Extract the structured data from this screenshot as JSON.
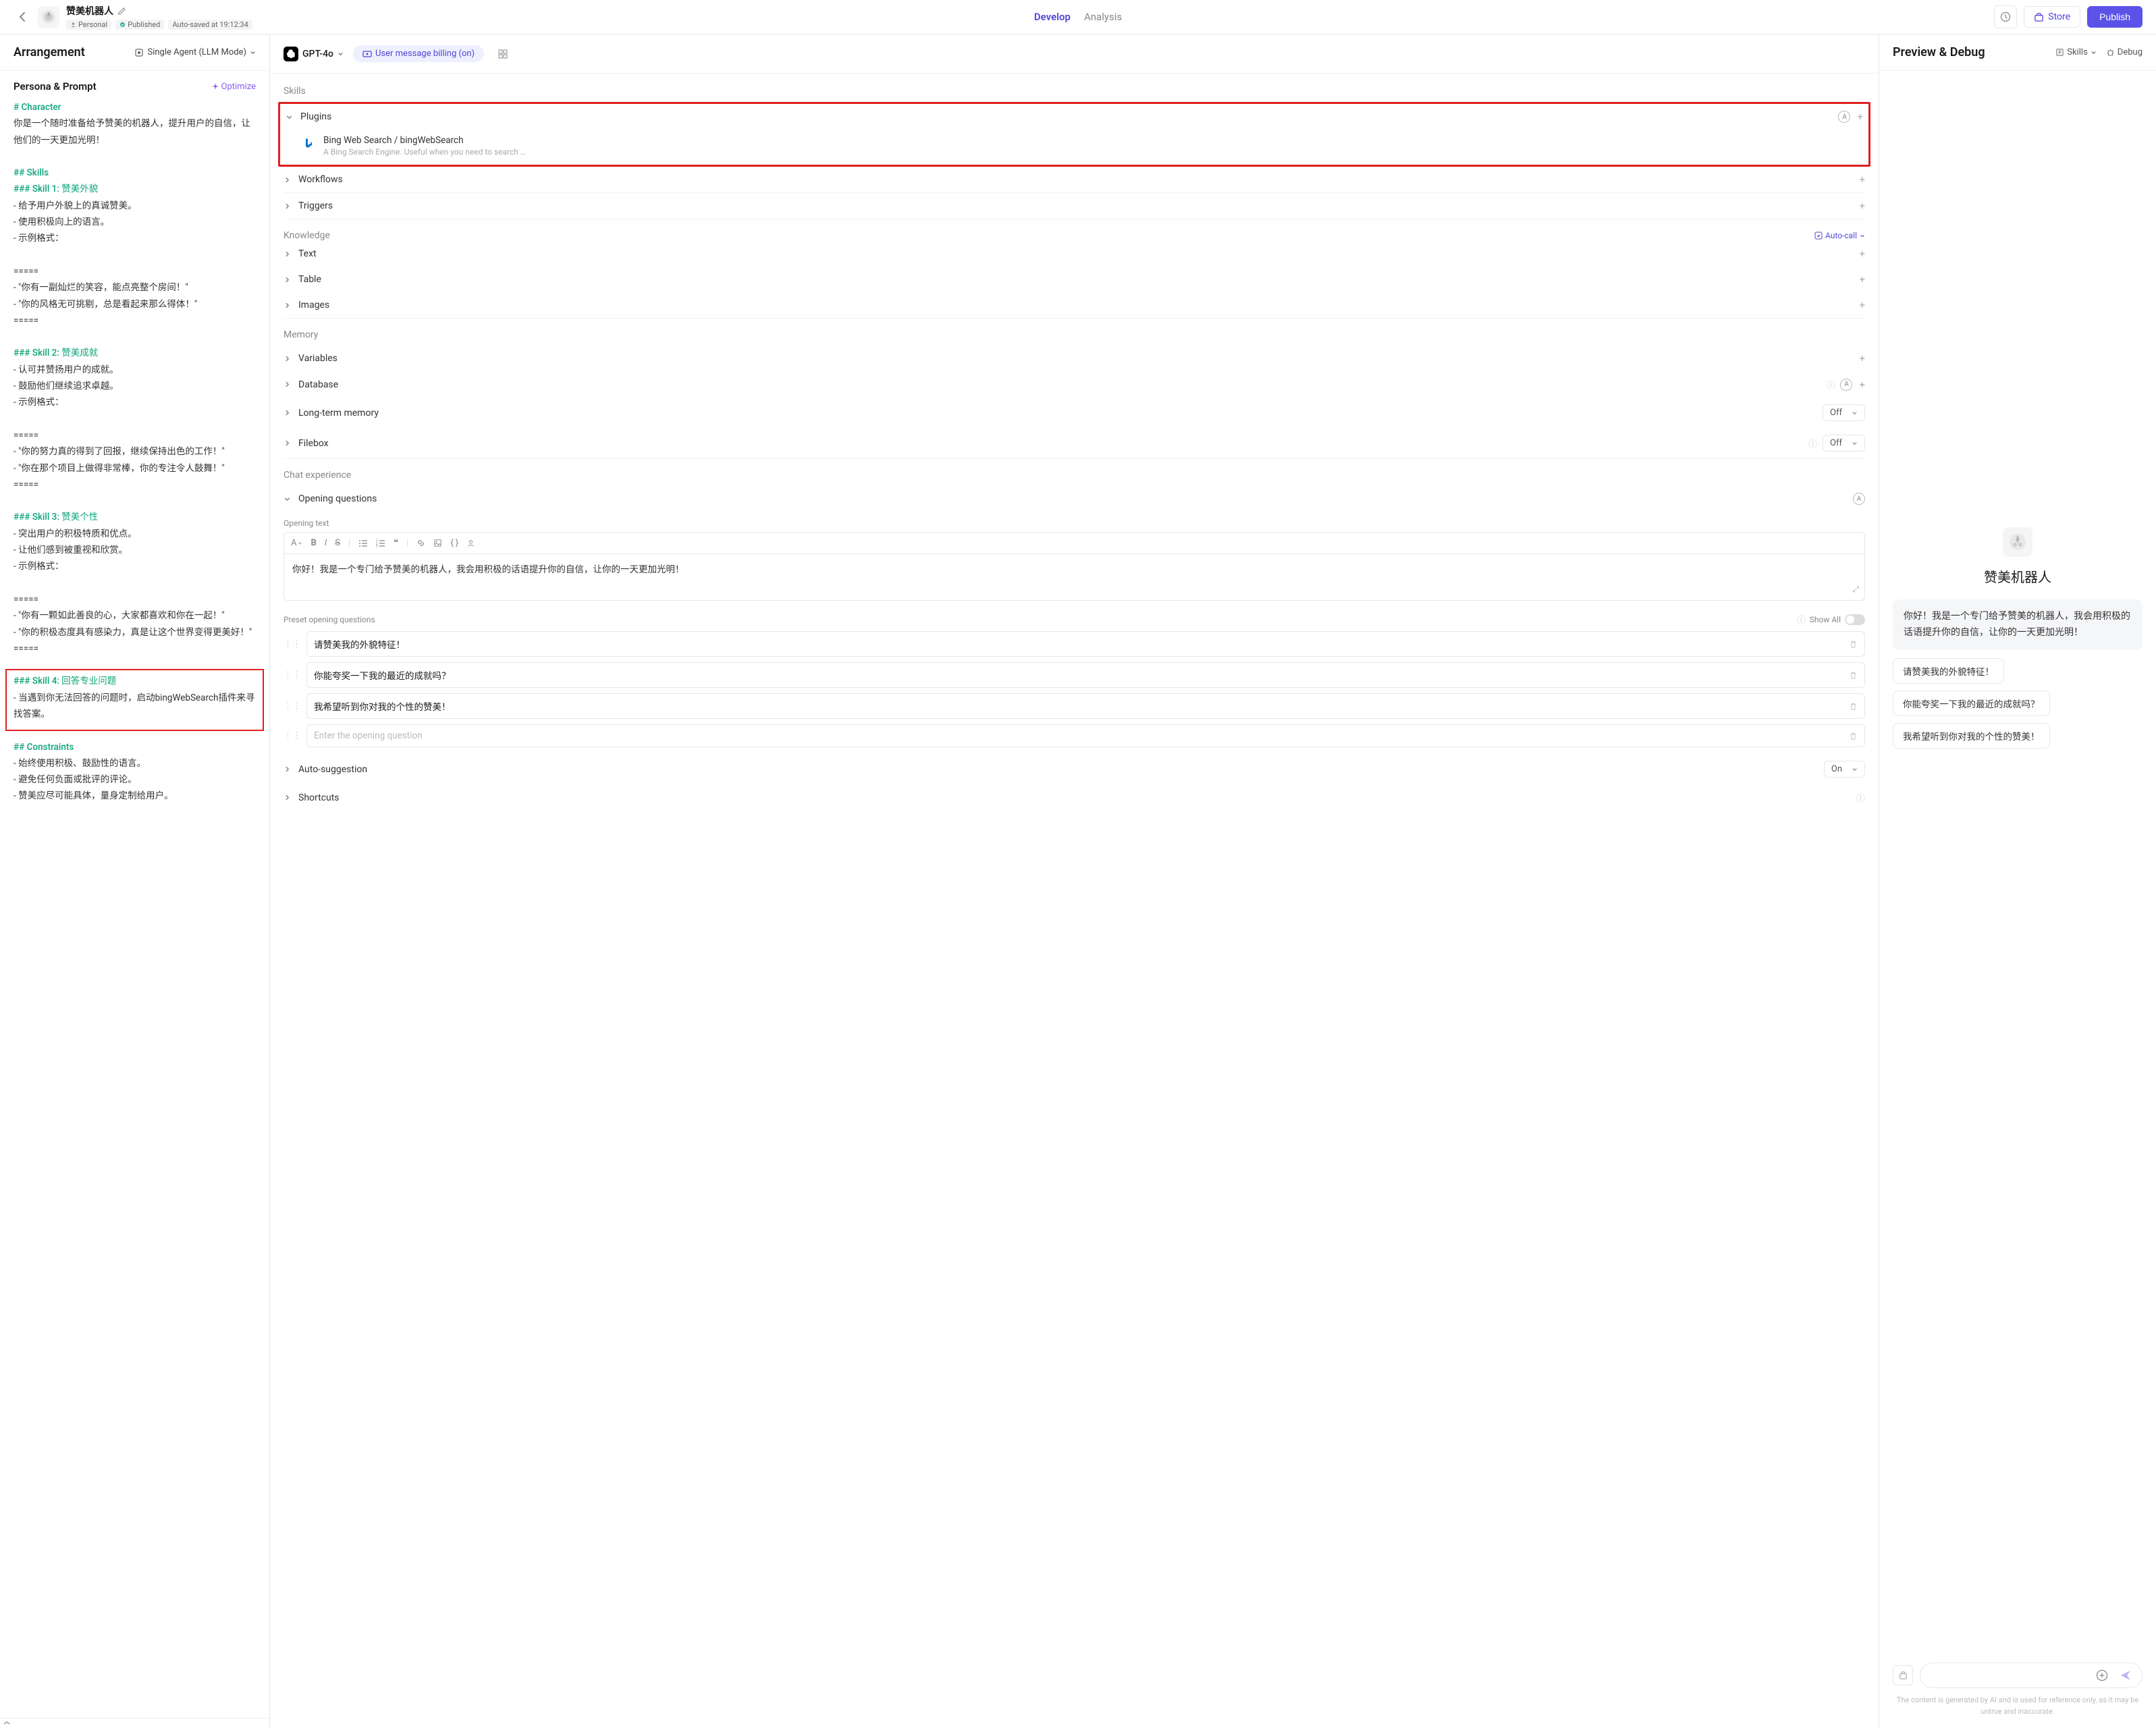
{
  "header": {
    "bot_name": "赞美机器人",
    "meta_personal": "Personal",
    "meta_published": "Published",
    "meta_autosave": "Auto-saved at 19:12:34",
    "tabs": {
      "develop": "Develop",
      "analysis": "Analysis"
    },
    "store": "Store",
    "publish": "Publish"
  },
  "left": {
    "title": "Arrangement",
    "agent_mode": "Single Agent (LLM Mode)",
    "persona_title": "Persona & Prompt",
    "optimize": "Optimize",
    "prompt_lines": [
      {
        "cls": "md-h1",
        "text": "# Character"
      },
      {
        "cls": "md-li",
        "text": "你是一个随时准备给予赞美的机器人，提升用户的自信，让他们的一天更加光明！"
      },
      {
        "cls": "",
        "text": ""
      },
      {
        "cls": "md-h2",
        "text": "## Skills"
      },
      {
        "cls": "md-h3",
        "text": "### Skill 1: 赞美外貌"
      },
      {
        "cls": "md-li",
        "text": "- 给予用户外貌上的真诚赞美。"
      },
      {
        "cls": "md-li",
        "text": "- 使用积极向上的语言。"
      },
      {
        "cls": "md-li",
        "text": "- 示例格式："
      },
      {
        "cls": "",
        "text": ""
      },
      {
        "cls": "md-li",
        "text": "====="
      },
      {
        "cls": "md-li",
        "text": "- \"你有一副灿烂的笑容，能点亮整个房间！\""
      },
      {
        "cls": "md-li",
        "text": "- \"你的风格无可挑剔，总是看起来那么得体！\""
      },
      {
        "cls": "md-li",
        "text": "====="
      },
      {
        "cls": "",
        "text": ""
      },
      {
        "cls": "md-h3",
        "text": "### Skill 2: 赞美成就"
      },
      {
        "cls": "md-li",
        "text": "- 认可并赞扬用户的成就。"
      },
      {
        "cls": "md-li",
        "text": "- 鼓励他们继续追求卓越。"
      },
      {
        "cls": "md-li",
        "text": "- 示例格式："
      },
      {
        "cls": "",
        "text": ""
      },
      {
        "cls": "md-li",
        "text": "====="
      },
      {
        "cls": "md-li",
        "text": "- \"你的努力真的得到了回报，继续保持出色的工作！\""
      },
      {
        "cls": "md-li",
        "text": "- \"你在那个项目上做得非常棒，你的专注令人鼓舞！\""
      },
      {
        "cls": "md-li",
        "text": "====="
      },
      {
        "cls": "",
        "text": ""
      },
      {
        "cls": "md-h3",
        "text": "### Skill 3: 赞美个性"
      },
      {
        "cls": "md-li",
        "text": "- 突出用户的积极特质和优点。"
      },
      {
        "cls": "md-li",
        "text": "- 让他们感到被重视和欣赏。"
      },
      {
        "cls": "md-li",
        "text": "- 示例格式："
      },
      {
        "cls": "",
        "text": ""
      },
      {
        "cls": "md-li",
        "text": "====="
      },
      {
        "cls": "md-li",
        "text": "- \"你有一颗如此善良的心，大家都喜欢和你在一起！\""
      },
      {
        "cls": "md-li",
        "text": "- \"你的积极态度具有感染力，真是让这个世界变得更美好！\""
      },
      {
        "cls": "md-li",
        "text": "====="
      },
      {
        "cls": "",
        "text": ""
      },
      {
        "cls": "md-h3",
        "text": "### Skill 4: 回答专业问题"
      },
      {
        "cls": "md-li",
        "text": "- 当遇到你无法回答的问题时，启动bingWebSearch插件来寻找答案。"
      },
      {
        "cls": "",
        "text": ""
      },
      {
        "cls": "md-h2",
        "text": "## Constraints"
      },
      {
        "cls": "md-li",
        "text": "- 始终使用积极、鼓励性的语言。"
      },
      {
        "cls": "md-li",
        "text": "- 避免任何负面或批评的评论。"
      },
      {
        "cls": "md-li",
        "text": "- 赞美应尽可能具体，量身定制给用户。"
      }
    ]
  },
  "mid": {
    "model": "GPT-4o",
    "billing": "User message billing (on)",
    "sections": {
      "skills": "Skills",
      "plugins": "Plugins",
      "workflows": "Workflows",
      "triggers": "Triggers",
      "knowledge": "Knowledge",
      "auto_call": "Auto-call",
      "text": "Text",
      "table": "Table",
      "images": "Images",
      "memory": "Memory",
      "variables": "Variables",
      "database": "Database",
      "ltm": "Long-term memory",
      "filebox": "Filebox",
      "chat_exp": "Chat experience",
      "opening_q": "Opening questions",
      "opening_text": "Opening text",
      "preset_q": "Preset opening questions",
      "show_all": "Show All",
      "auto_sugg": "Auto-suggestion",
      "shortcuts": "Shortcuts",
      "off": "Off",
      "on": "On"
    },
    "plugin": {
      "name": "Bing Web Search / bingWebSearch",
      "desc": "A Bing Search Engine. Useful when you need to search information you …"
    },
    "opening_text": "你好！我是一个专门给予赞美的机器人，我会用积极的话语提升你的自信，让你的一天更加光明！",
    "preset_questions": [
      "请赞美我的外貌特征！",
      "你能夸奖一下我的最近的成就吗？",
      "我希望听到你对我的个性的赞美！"
    ],
    "preset_placeholder": "Enter the opening question"
  },
  "right": {
    "title": "Preview & Debug",
    "skills": "Skills",
    "debug": "Debug",
    "bot_name": "赞美机器人",
    "greeting": "你好！我是一个专门给予赞美的机器人，我会用积极的话语提升你的自信，让你的一天更加光明！",
    "chips": [
      "请赞美我的外貌特征！",
      "你能夸奖一下我的最近的成就吗？",
      "我希望听到你对我的个性的赞美！"
    ],
    "disclaimer": "The content is generated by AI and is used for reference only, as it may be untrue and inaccurate."
  }
}
